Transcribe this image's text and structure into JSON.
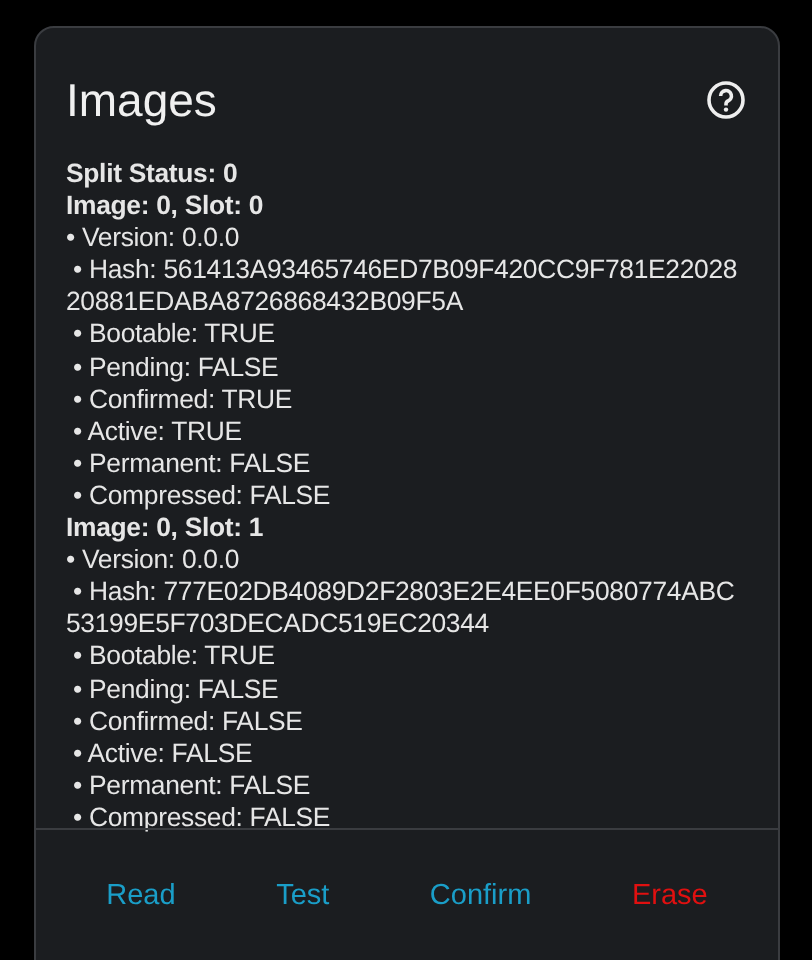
{
  "title": "Images",
  "lines": [
    {
      "kind": "heading",
      "text": "Split Status: 0"
    },
    {
      "kind": "heading",
      "text": "Image: 0, Slot: 0"
    },
    {
      "kind": "item",
      "text": "• Version: 0.0.0"
    },
    {
      "kind": "item",
      "text": " • Hash: 561413A93465746ED7B09F420CC9F781E2202820881EDABA8726868432B09F5A"
    },
    {
      "kind": "item",
      "text": " • Bootable: TRUE"
    },
    {
      "kind": "item",
      "text": " • Pending: FALSE"
    },
    {
      "kind": "item",
      "text": " • Confirmed: TRUE"
    },
    {
      "kind": "item",
      "text": " • Active: TRUE"
    },
    {
      "kind": "item",
      "text": " • Permanent: FALSE"
    },
    {
      "kind": "item",
      "text": " • Compressed: FALSE"
    },
    {
      "kind": "heading",
      "text": "Image: 0, Slot: 1"
    },
    {
      "kind": "item",
      "text": "• Version: 0.0.0"
    },
    {
      "kind": "item",
      "text": " • Hash: 777E02DB4089D2F2803E2E4EE0F5080774ABC53199E5F703DECADC519EC20344"
    },
    {
      "kind": "item",
      "text": " • Bootable: TRUE"
    },
    {
      "kind": "item",
      "text": " • Pending: FALSE"
    },
    {
      "kind": "item",
      "text": " • Confirmed: FALSE"
    },
    {
      "kind": "item",
      "text": " • Active: FALSE"
    },
    {
      "kind": "item",
      "text": " • Permanent: FALSE"
    },
    {
      "kind": "item",
      "text": " • Compressed: FALSE"
    }
  ],
  "buttons": [
    {
      "label": "Read",
      "color": "#1a9ec8"
    },
    {
      "label": "Test",
      "color": "#1a9ec8"
    },
    {
      "label": "Confirm",
      "color": "#1a9ec8"
    },
    {
      "label": "Erase",
      "color": "#e01010"
    }
  ]
}
